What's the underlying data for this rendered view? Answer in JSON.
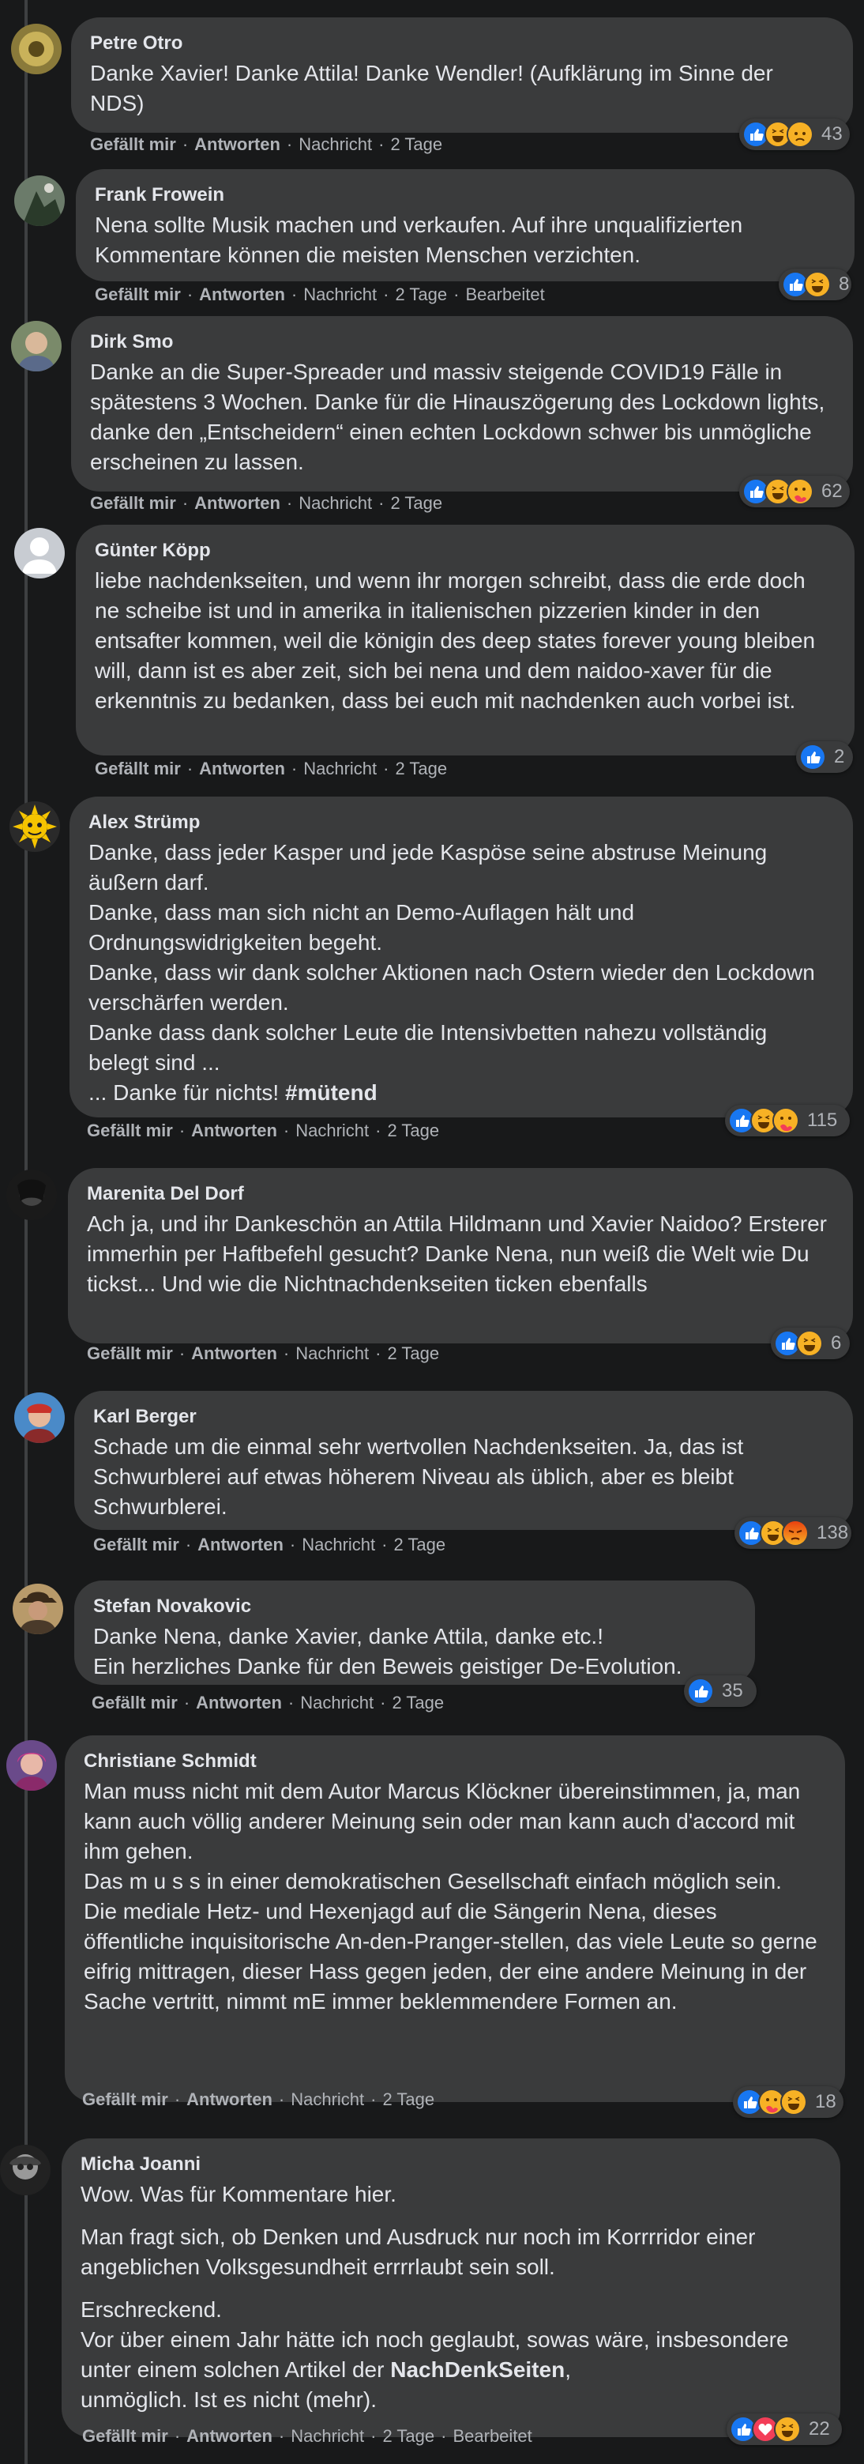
{
  "actions": {
    "like": "Gefällt mir",
    "reply": "Antworten",
    "message": "Nachricht",
    "separator": "·",
    "edited": "Bearbeitet"
  },
  "colors": {
    "background": "#18191a",
    "bubble": "#3a3b3c",
    "like": "#1877f2",
    "love": "#f33e58",
    "haha": "#f7b125",
    "angry": "#e9710f"
  },
  "comments": [
    {
      "author": "Petre Otro",
      "paragraphs": [
        "Danke Xavier! Danke Attila! Danke Wendler! (Aufklärung im Sinne der NDS)"
      ],
      "reactions": [
        "like",
        "haha",
        "sad"
      ],
      "count": "43",
      "time": "2 Tage",
      "edited": false
    },
    {
      "author": "Frank Frowein",
      "paragraphs": [
        "Nena sollte Musik machen und verkaufen. Auf ihre unqualifizierten Kommentare können die meisten Menschen verzichten."
      ],
      "reactions": [
        "like",
        "haha"
      ],
      "count": "8",
      "time": "2 Tage",
      "edited": true
    },
    {
      "author": "Dirk Smo",
      "paragraphs": [
        "Danke an die Super-Spreader und massiv steigende COVID19 Fälle in spätestens 3 Wochen. Danke für die Hinauszögerung des Lockdown lights, danke den „Entscheidern“ einen echten Lockdown schwer bis unmögliche erscheinen zu lassen."
      ],
      "reactions": [
        "like",
        "haha",
        "care"
      ],
      "count": "62",
      "time": "2 Tage",
      "edited": false
    },
    {
      "author": "Günter Köpp",
      "paragraphs": [
        "liebe nachdenkseiten, und wenn ihr morgen schreibt, dass die erde doch ne scheibe ist und in amerika in italienischen pizzerien kinder in den entsafter kommen, weil die königin des deep states forever young bleiben will, dann ist es aber zeit, sich bei nena und dem naidoo-xaver für die erkenntnis zu bedanken, dass bei euch mit nachdenken auch vorbei ist."
      ],
      "reactions": [
        "like"
      ],
      "count": "2",
      "time": "2 Tage",
      "edited": false
    },
    {
      "author": "Alex Strümp",
      "paragraphs": [
        "Danke, dass jeder Kasper und jede Kaspöse seine abstruse Meinung äußern darf.\nDanke, dass man sich nicht an Demo-Auflagen hält und Ordnungswidrigkeiten begeht.\nDanke, dass wir dank solcher Aktionen nach Ostern wieder den Lockdown verschärfen werden.\nDanke dass dank solcher Leute die Intensivbetten nahezu vollständig belegt sind ...\n... Danke für nichts! "
      ],
      "hashtag": "#mütend",
      "reactions": [
        "like",
        "haha",
        "care"
      ],
      "count": "115",
      "time": "2 Tage",
      "edited": false
    },
    {
      "author": "Marenita Del Dorf",
      "paragraphs": [
        "Ach ja, und ihr Dankeschön an Attila Hildmann und Xavier Naidoo? Ersterer immerhin per Haftbefehl gesucht? Danke Nena, nun weiß die Welt wie Du tickst... Und wie die Nichtnachdenkseiten ticken ebenfalls"
      ],
      "reactions": [
        "like",
        "haha"
      ],
      "count": "6",
      "time": "2 Tage",
      "edited": false
    },
    {
      "author": "Karl Berger",
      "paragraphs": [
        "Schade um die einmal sehr wertvollen Nachdenkseiten. Ja, das ist Schwurblerei auf etwas höherem Niveau als üblich, aber es bleibt Schwurblerei."
      ],
      "reactions": [
        "like",
        "haha",
        "angry"
      ],
      "count": "138",
      "time": "2 Tage",
      "edited": false
    },
    {
      "author": "Stefan Novakovic",
      "paragraphs": [
        "Danke Nena, danke Xavier, danke Attila, danke etc.!\nEin herzliches Danke für den Beweis geistiger De-Evolution."
      ],
      "reactions": [
        "like"
      ],
      "count": "35",
      "time": "2 Tage",
      "edited": false
    },
    {
      "author": "Christiane Schmidt",
      "paragraphs": [
        "Man muss nicht mit dem Autor Marcus Klöckner übereinstimmen, ja, man kann auch völlig anderer Meinung sein oder man kann auch d'accord mit ihm gehen.\nDas m u s s in einer demokratischen Gesellschaft einfach möglich sein.\nDie mediale Hetz- und Hexenjagd auf die Sängerin Nena, dieses öffentliche inquisitorische An-den-Pranger-stellen, das viele Leute so gerne eifrig mittragen, dieser Hass gegen jeden, der eine andere Meinung in der Sache vertritt, nimmt mE immer beklemmendere Formen an."
      ],
      "reactions": [
        "like",
        "care",
        "haha"
      ],
      "count": "18",
      "time": "2 Tage",
      "edited": false
    },
    {
      "author": "Micha Joanni",
      "paragraphs": [
        "Wow. Was für Kommentare hier.",
        "Man fragt sich, ob Denken und Ausdruck nur noch im Korrrridor einer angeblichen Volksgesundheit errrrlaubt sein soll.",
        "Erschreckend.\nVor über einem Jahr hätte ich noch geglaubt, sowas wäre, insbesondere unter einem solchen Artikel der "
      ],
      "bold_tail": "NachDenkSeiten",
      "tail_after": ",\nunmöglich. Ist es nicht (mehr).",
      "reactions": [
        "like",
        "love",
        "haha"
      ],
      "count": "22",
      "time": "2 Tage",
      "edited": true
    }
  ]
}
